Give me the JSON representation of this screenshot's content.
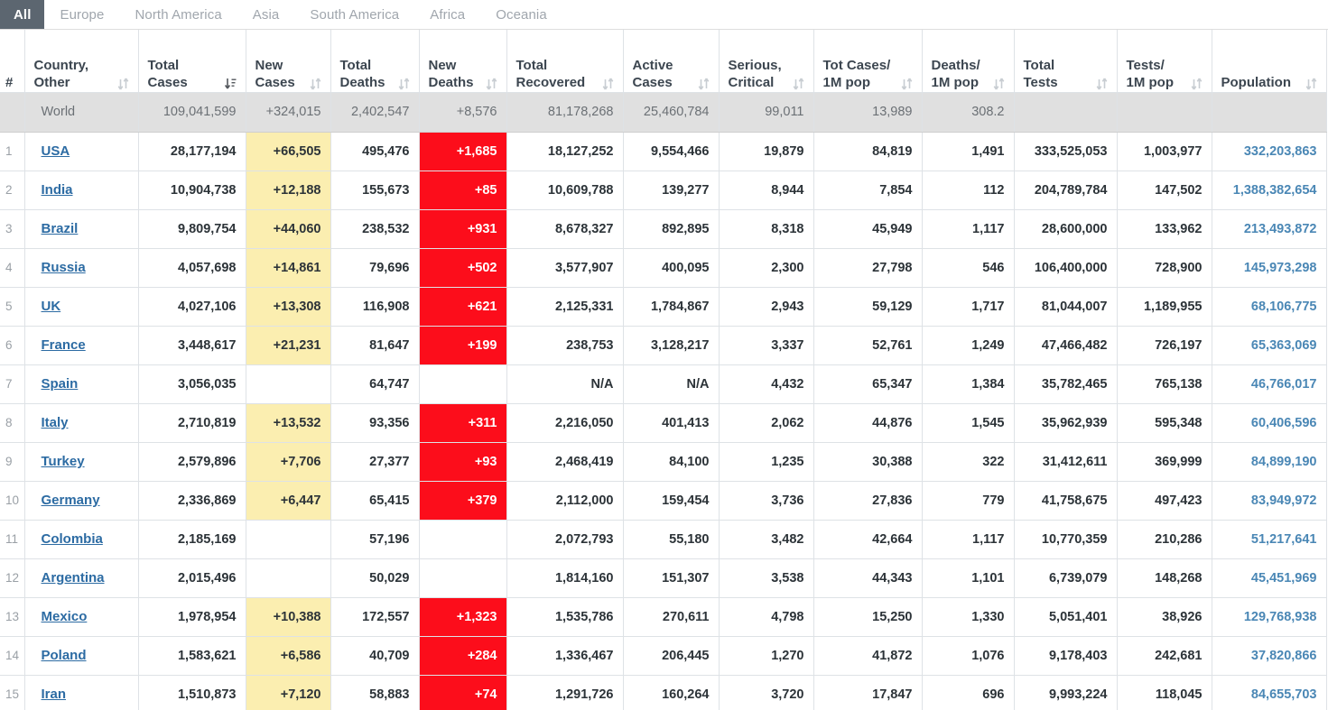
{
  "tabs": [
    {
      "label": "All",
      "active": true
    },
    {
      "label": "Europe",
      "active": false
    },
    {
      "label": "North America",
      "active": false
    },
    {
      "label": "Asia",
      "active": false
    },
    {
      "label": "South America",
      "active": false
    },
    {
      "label": "Africa",
      "active": false
    },
    {
      "label": "Oceania",
      "active": false
    }
  ],
  "columns": [
    {
      "key": "idx",
      "line1": "#",
      "line2": "",
      "sort": "none"
    },
    {
      "key": "ctry",
      "line1": "Country,",
      "line2": "Other",
      "sort": "both"
    },
    {
      "key": "tc",
      "line1": "Total",
      "line2": "Cases",
      "sort": "desc"
    },
    {
      "key": "nc",
      "line1": "New",
      "line2": "Cases",
      "sort": "both"
    },
    {
      "key": "td",
      "line1": "Total",
      "line2": "Deaths",
      "sort": "both"
    },
    {
      "key": "nd",
      "line1": "New",
      "line2": "Deaths",
      "sort": "both"
    },
    {
      "key": "tr",
      "line1": "Total",
      "line2": "Recovered",
      "sort": "both"
    },
    {
      "key": "ac",
      "line1": "Active",
      "line2": "Cases",
      "sort": "both"
    },
    {
      "key": "sc",
      "line1": "Serious,",
      "line2": "Critical",
      "sort": "both"
    },
    {
      "key": "tcm",
      "line1": "Tot Cases/",
      "line2": "1M pop",
      "sort": "both"
    },
    {
      "key": "dpm",
      "line1": "Deaths/",
      "line2": "1M pop",
      "sort": "both"
    },
    {
      "key": "tt",
      "line1": "Total",
      "line2": "Tests",
      "sort": "both"
    },
    {
      "key": "tpm",
      "line1": "Tests/",
      "line2": "1M pop",
      "sort": "both"
    },
    {
      "key": "popc",
      "line1": "Population",
      "line2": "",
      "sort": "both"
    }
  ],
  "world_row": {
    "idx": "",
    "country": "World",
    "total_cases": "109,041,599",
    "new_cases": "+324,015",
    "total_deaths": "2,402,547",
    "new_deaths": "+8,576",
    "total_recovered": "81,178,268",
    "active_cases": "25,460,784",
    "serious_critical": "99,011",
    "tot_cases_1m": "13,989",
    "deaths_1m": "308.2",
    "total_tests": "",
    "tests_1m": "",
    "population": ""
  },
  "rows": [
    {
      "idx": "1",
      "country": "USA",
      "total_cases": "28,177,194",
      "new_cases": "+66,505",
      "total_deaths": "495,476",
      "new_deaths": "+1,685",
      "total_recovered": "18,127,252",
      "active_cases": "9,554,466",
      "serious_critical": "19,879",
      "tot_cases_1m": "84,819",
      "deaths_1m": "1,491",
      "total_tests": "333,525,053",
      "tests_1m": "1,003,977",
      "population": "332,203,863"
    },
    {
      "idx": "2",
      "country": "India",
      "total_cases": "10,904,738",
      "new_cases": "+12,188",
      "total_deaths": "155,673",
      "new_deaths": "+85",
      "total_recovered": "10,609,788",
      "active_cases": "139,277",
      "serious_critical": "8,944",
      "tot_cases_1m": "7,854",
      "deaths_1m": "112",
      "total_tests": "204,789,784",
      "tests_1m": "147,502",
      "population": "1,388,382,654"
    },
    {
      "idx": "3",
      "country": "Brazil",
      "total_cases": "9,809,754",
      "new_cases": "+44,060",
      "total_deaths": "238,532",
      "new_deaths": "+931",
      "total_recovered": "8,678,327",
      "active_cases": "892,895",
      "serious_critical": "8,318",
      "tot_cases_1m": "45,949",
      "deaths_1m": "1,117",
      "total_tests": "28,600,000",
      "tests_1m": "133,962",
      "population": "213,493,872"
    },
    {
      "idx": "4",
      "country": "Russia",
      "total_cases": "4,057,698",
      "new_cases": "+14,861",
      "total_deaths": "79,696",
      "new_deaths": "+502",
      "total_recovered": "3,577,907",
      "active_cases": "400,095",
      "serious_critical": "2,300",
      "tot_cases_1m": "27,798",
      "deaths_1m": "546",
      "total_tests": "106,400,000",
      "tests_1m": "728,900",
      "population": "145,973,298"
    },
    {
      "idx": "5",
      "country": "UK",
      "total_cases": "4,027,106",
      "new_cases": "+13,308",
      "total_deaths": "116,908",
      "new_deaths": "+621",
      "total_recovered": "2,125,331",
      "active_cases": "1,784,867",
      "serious_critical": "2,943",
      "tot_cases_1m": "59,129",
      "deaths_1m": "1,717",
      "total_tests": "81,044,007",
      "tests_1m": "1,189,955",
      "population": "68,106,775"
    },
    {
      "idx": "6",
      "country": "France",
      "total_cases": "3,448,617",
      "new_cases": "+21,231",
      "total_deaths": "81,647",
      "new_deaths": "+199",
      "total_recovered": "238,753",
      "active_cases": "3,128,217",
      "serious_critical": "3,337",
      "tot_cases_1m": "52,761",
      "deaths_1m": "1,249",
      "total_tests": "47,466,482",
      "tests_1m": "726,197",
      "population": "65,363,069"
    },
    {
      "idx": "7",
      "country": "Spain",
      "total_cases": "3,056,035",
      "new_cases": "",
      "total_deaths": "64,747",
      "new_deaths": "",
      "total_recovered": "N/A",
      "active_cases": "N/A",
      "serious_critical": "4,432",
      "tot_cases_1m": "65,347",
      "deaths_1m": "1,384",
      "total_tests": "35,782,465",
      "tests_1m": "765,138",
      "population": "46,766,017"
    },
    {
      "idx": "8",
      "country": "Italy",
      "total_cases": "2,710,819",
      "new_cases": "+13,532",
      "total_deaths": "93,356",
      "new_deaths": "+311",
      "total_recovered": "2,216,050",
      "active_cases": "401,413",
      "serious_critical": "2,062",
      "tot_cases_1m": "44,876",
      "deaths_1m": "1,545",
      "total_tests": "35,962,939",
      "tests_1m": "595,348",
      "population": "60,406,596"
    },
    {
      "idx": "9",
      "country": "Turkey",
      "total_cases": "2,579,896",
      "new_cases": "+7,706",
      "total_deaths": "27,377",
      "new_deaths": "+93",
      "total_recovered": "2,468,419",
      "active_cases": "84,100",
      "serious_critical": "1,235",
      "tot_cases_1m": "30,388",
      "deaths_1m": "322",
      "total_tests": "31,412,611",
      "tests_1m": "369,999",
      "population": "84,899,190"
    },
    {
      "idx": "10",
      "country": "Germany",
      "total_cases": "2,336,869",
      "new_cases": "+6,447",
      "total_deaths": "65,415",
      "new_deaths": "+379",
      "total_recovered": "2,112,000",
      "active_cases": "159,454",
      "serious_critical": "3,736",
      "tot_cases_1m": "27,836",
      "deaths_1m": "779",
      "total_tests": "41,758,675",
      "tests_1m": "497,423",
      "population": "83,949,972"
    },
    {
      "idx": "11",
      "country": "Colombia",
      "total_cases": "2,185,169",
      "new_cases": "",
      "total_deaths": "57,196",
      "new_deaths": "",
      "total_recovered": "2,072,793",
      "active_cases": "55,180",
      "serious_critical": "3,482",
      "tot_cases_1m": "42,664",
      "deaths_1m": "1,117",
      "total_tests": "10,770,359",
      "tests_1m": "210,286",
      "population": "51,217,641"
    },
    {
      "idx": "12",
      "country": "Argentina",
      "total_cases": "2,015,496",
      "new_cases": "",
      "total_deaths": "50,029",
      "new_deaths": "",
      "total_recovered": "1,814,160",
      "active_cases": "151,307",
      "serious_critical": "3,538",
      "tot_cases_1m": "44,343",
      "deaths_1m": "1,101",
      "total_tests": "6,739,079",
      "tests_1m": "148,268",
      "population": "45,451,969"
    },
    {
      "idx": "13",
      "country": "Mexico",
      "total_cases": "1,978,954",
      "new_cases": "+10,388",
      "total_deaths": "172,557",
      "new_deaths": "+1,323",
      "total_recovered": "1,535,786",
      "active_cases": "270,611",
      "serious_critical": "4,798",
      "tot_cases_1m": "15,250",
      "deaths_1m": "1,330",
      "total_tests": "5,051,401",
      "tests_1m": "38,926",
      "population": "129,768,938"
    },
    {
      "idx": "14",
      "country": "Poland",
      "total_cases": "1,583,621",
      "new_cases": "+6,586",
      "total_deaths": "40,709",
      "new_deaths": "+284",
      "total_recovered": "1,336,467",
      "active_cases": "206,445",
      "serious_critical": "1,270",
      "tot_cases_1m": "41,872",
      "deaths_1m": "1,076",
      "total_tests": "9,178,403",
      "tests_1m": "242,681",
      "population": "37,820,866"
    },
    {
      "idx": "15",
      "country": "Iran",
      "total_cases": "1,510,873",
      "new_cases": "+7,120",
      "total_deaths": "58,883",
      "new_deaths": "+74",
      "total_recovered": "1,291,726",
      "active_cases": "160,264",
      "serious_critical": "3,720",
      "tot_cases_1m": "17,847",
      "deaths_1m": "696",
      "total_tests": "9,993,224",
      "tests_1m": "118,045",
      "population": "84,655,703"
    }
  ],
  "colors": {
    "new_cases_bg": "#fbeeb0",
    "new_deaths_bg": "#fc0d1b",
    "world_row_bg": "#e0e0e0",
    "active_tab_bg": "#5c6670",
    "link": "#2c6ba3",
    "population_text": "#4a87b5"
  }
}
